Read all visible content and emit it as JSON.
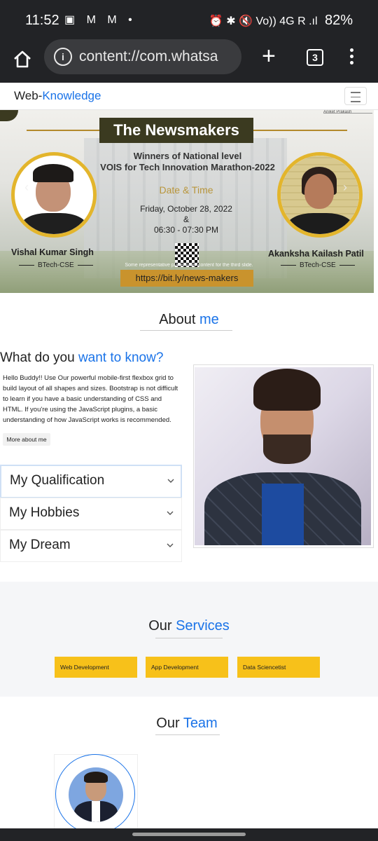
{
  "status_bar": {
    "time": "11:52",
    "notif_icons": "▣ M M •",
    "system_icons": "⏰ ✱ 🔇 Vo)) 4G R .ıl",
    "battery": "82%"
  },
  "browser": {
    "url": "content://com.whatsa",
    "tab_count": "3"
  },
  "navbar": {
    "brand_prefix": "Web-",
    "brand_suffix": "Knowledge"
  },
  "banner": {
    "heading": "The Newsmakers",
    "subtitle_line1": "Winners of National level",
    "subtitle_line2": "VOIS for Tech Innovation Marathon-2022",
    "datetime_label": "Date & Time",
    "date": "Friday, October 28, 2022",
    "amp": "&",
    "time": "06:30 - 07:30 PM",
    "left_name": "Vishal Kumar Singh",
    "left_degree": "BTech-CSE",
    "right_name": "Akanksha Kailash Patil",
    "right_degree": "BTech-CSE",
    "qr_note": "Some representative placeholder content for the third slide.",
    "link": "https://bit.ly/news-makers",
    "corner_text": "Aniket Prakash"
  },
  "about": {
    "title_prefix": "About ",
    "title_accent": "me",
    "question_prefix": "What do you ",
    "question_accent": "want to know?",
    "body": "Hello Buddy!! Use Our powerful mobile-first flexbox grid to build layout of all shapes and sizes. Bootstrap is not difficult to learn if you have a basic understanding of CSS and HTML. If you're using the JavaScript plugins, a basic understanding of how JavaScript works is recommended.",
    "more_button": "More about me",
    "accordion": [
      {
        "label": "My Qualification"
      },
      {
        "label": "My Hobbies"
      },
      {
        "label": "My Dream"
      }
    ]
  },
  "services": {
    "title_prefix": "Our ",
    "title_accent": "Services",
    "items": [
      {
        "label": "Web Development"
      },
      {
        "label": "App Development"
      },
      {
        "label": "Data Sciencetist"
      }
    ],
    "color": "#f7c11a"
  },
  "team": {
    "title_prefix": "Our ",
    "title_accent": "Team"
  },
  "colors": {
    "accent": "#1a73e8",
    "banner_gold": "#c9932d",
    "chrome_dark": "#222326"
  }
}
